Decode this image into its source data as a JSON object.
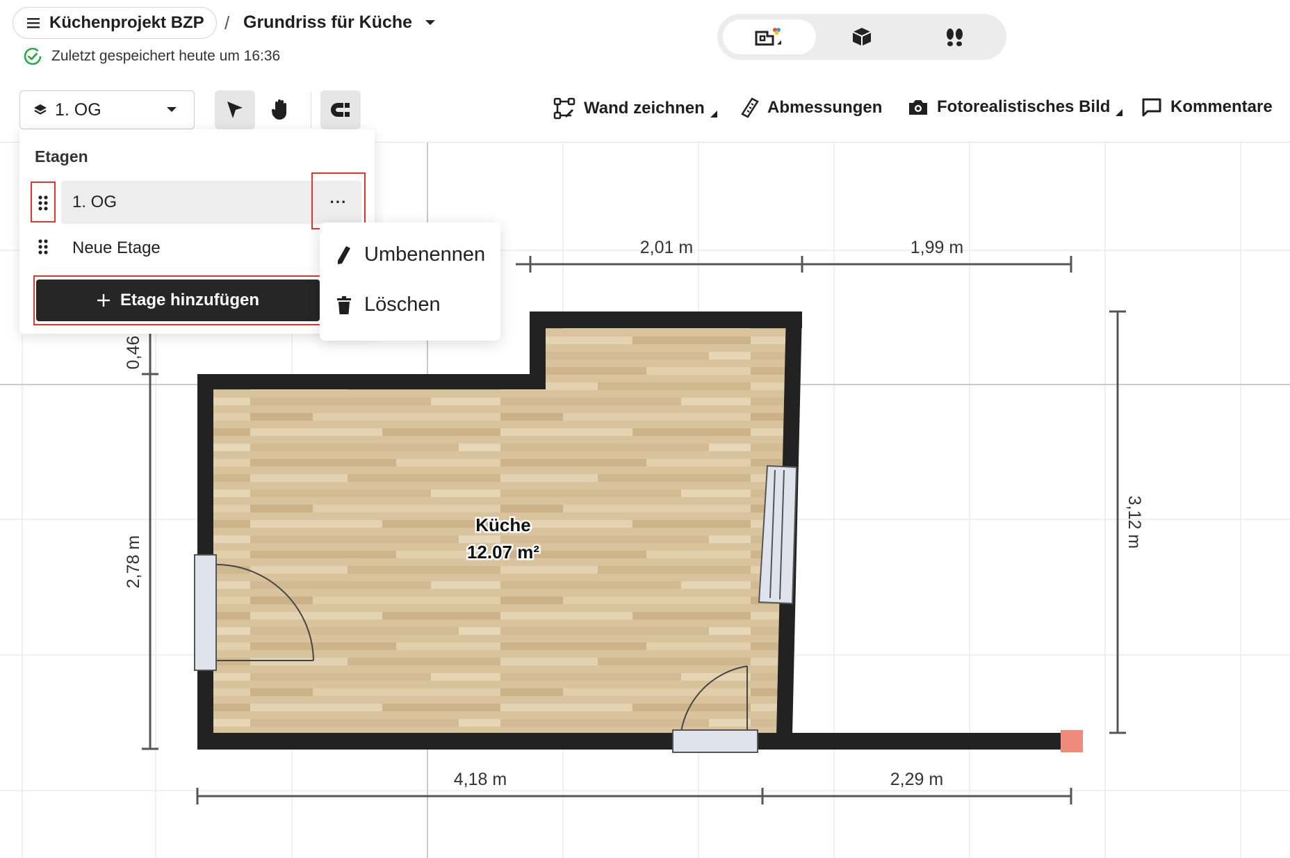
{
  "header": {
    "project_name": "Küchenprojekt BZP",
    "separator": "/",
    "plan_name": "Grundriss für Küche",
    "save_status": "Zuletzt gespeichert heute um 16:36",
    "views": [
      {
        "icon": "2d-plan-icon",
        "active": true
      },
      {
        "icon": "3d-box-icon",
        "active": false
      },
      {
        "icon": "walkthrough-footsteps-icon",
        "active": false
      }
    ]
  },
  "toolbar": {
    "floor_select_value": "1. OG",
    "wall_draw_label": "Wand zeichnen",
    "dimensions_label": "Abmessungen",
    "photo_label": "Fotorealistisches Bild",
    "comments_label": "Kommentare"
  },
  "floor_panel": {
    "title": "Etagen",
    "floors": [
      {
        "name": "1. OG",
        "active": true
      },
      {
        "name": "Neue Etage",
        "active": false
      }
    ],
    "add_floor_label": "Etage hinzufügen",
    "more_label": "···"
  },
  "context_menu": {
    "rename_label": "Umbenennen",
    "delete_label": "Löschen"
  },
  "plan": {
    "room_name": "Küche",
    "room_area": "12.07 m²",
    "dimensions": {
      "top_left": "2,01 m",
      "top_right": "1,99 m",
      "right": "3,12 m",
      "left_upper": "0,46",
      "left_lower": "2,78 m",
      "bottom_left": "4,18 m",
      "bottom_right": "2,29 m"
    }
  },
  "colors": {
    "wall": "#222222",
    "floor_wood": "#d9c39c",
    "accent_green": "#2aa84a",
    "highlight_red": "#e3342f",
    "endpoint": "#f08a7a"
  }
}
